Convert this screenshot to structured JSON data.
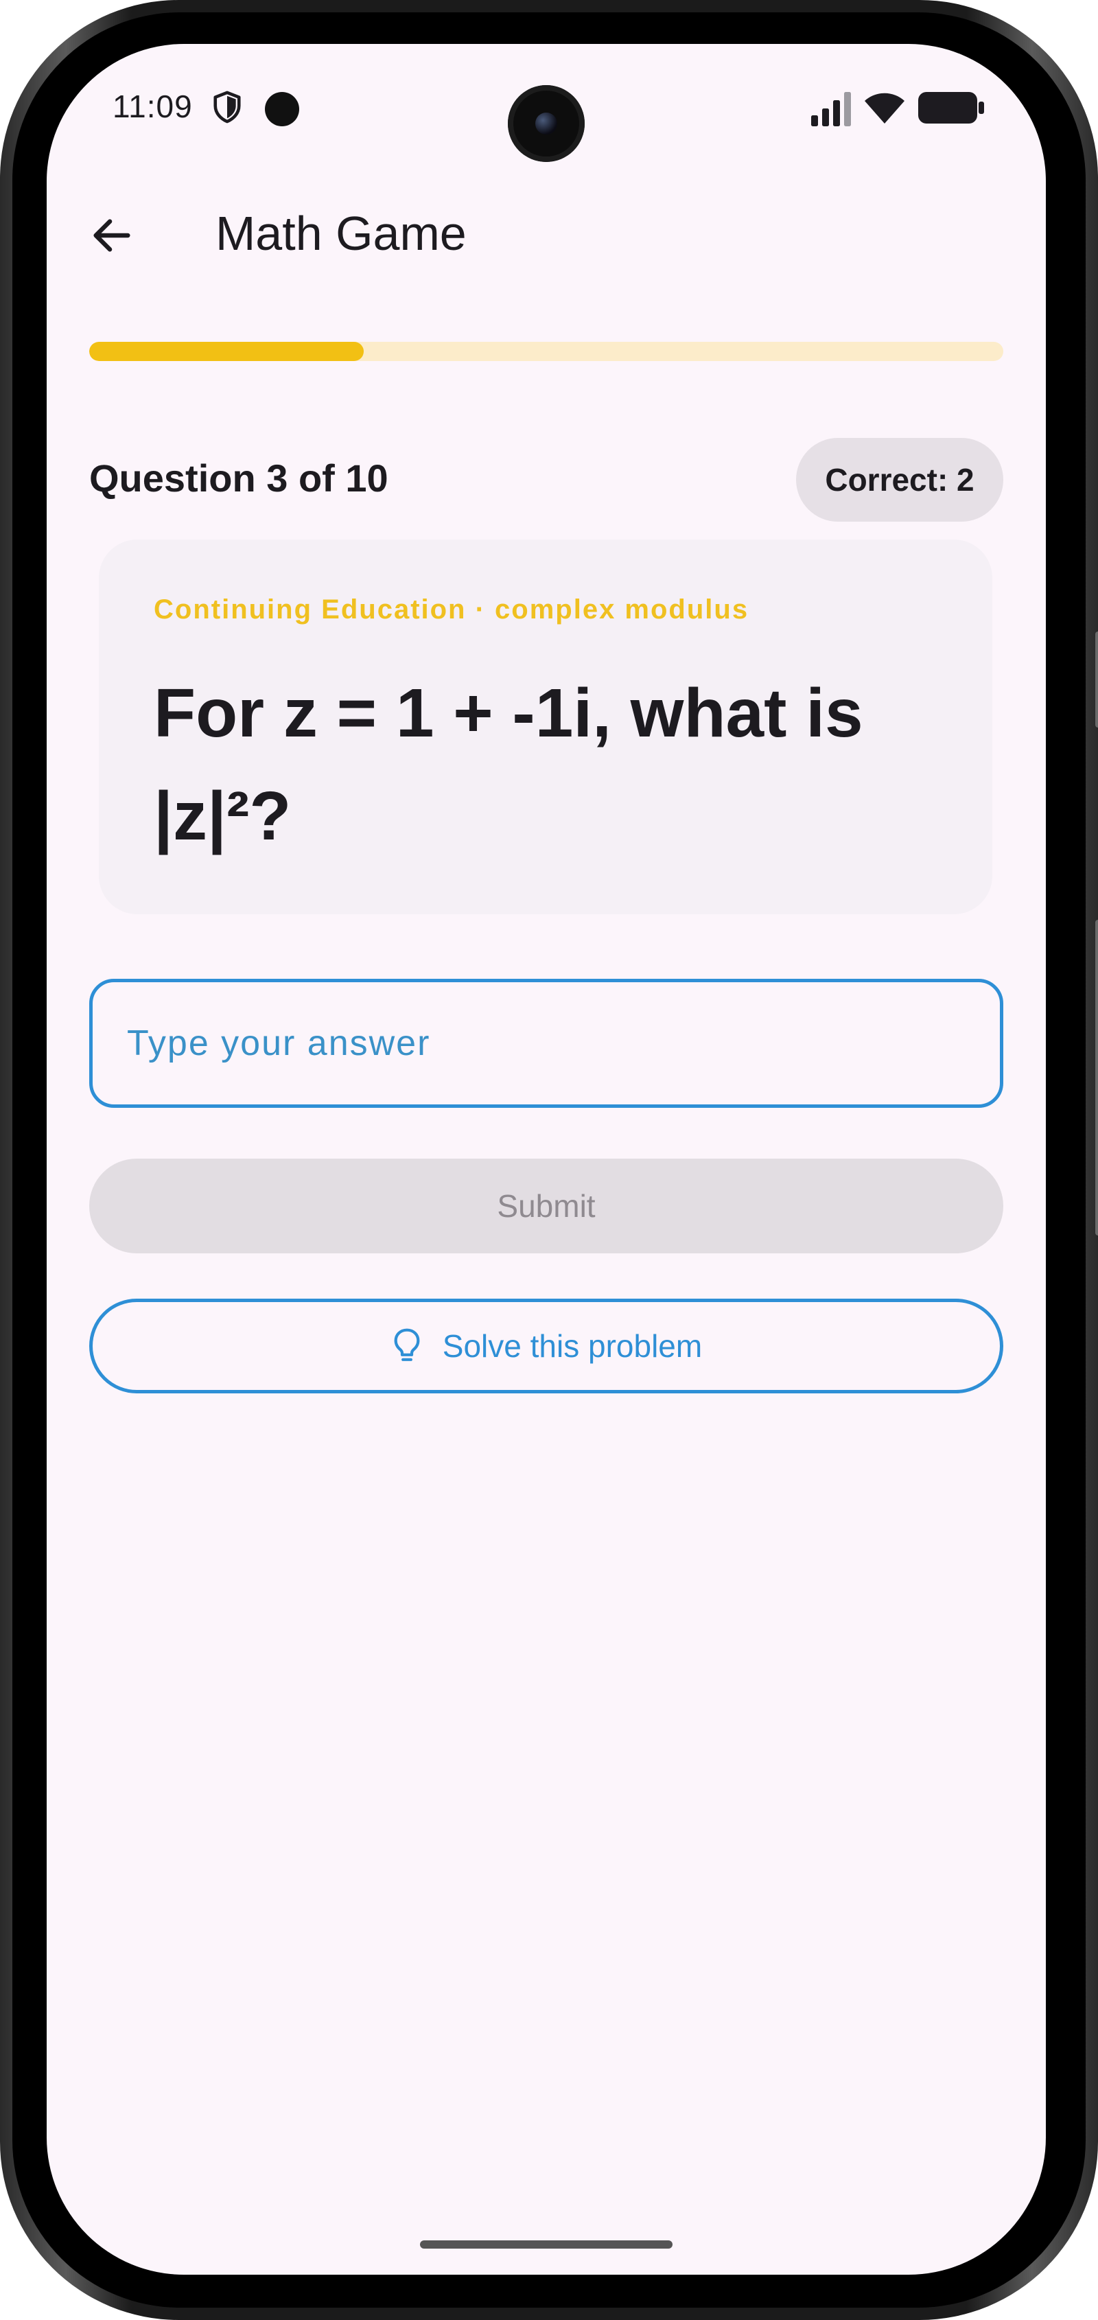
{
  "status_bar": {
    "time": "11:09"
  },
  "app_bar": {
    "title": "Math Game",
    "back_icon": "arrow-left-icon"
  },
  "progress": {
    "fraction": 0.3,
    "fill_color": "#f2c014",
    "track_color": "#fcecca"
  },
  "quiz": {
    "question_count": "Question 3 of 10",
    "correct_badge": "Correct: 2",
    "category": "Continuing Education · complex modulus",
    "question": "For z = 1 + -1i, what is |z|²?"
  },
  "answer": {
    "placeholder": "Type your answer",
    "value": ""
  },
  "buttons": {
    "submit_label": "Submit",
    "solve_label": "Solve this problem",
    "solve_icon": "lightbulb-icon"
  },
  "colors": {
    "accent": "#2e8fd6",
    "category": "#f0c020",
    "background": "#fcf5fb"
  }
}
